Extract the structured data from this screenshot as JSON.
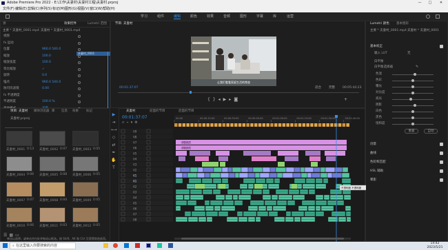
{
  "window": {
    "title": "Adobe Premiere Pro 2022 - E:\\工作\\夫妻村\\夫妻村工程\\夫妻村.prproj",
    "controls": [
      "—",
      "□",
      "✕"
    ]
  },
  "menu": [
    "文件(F)",
    "编辑(E)",
    "剪辑(C)",
    "序列(S)",
    "标记(M)",
    "图形(G)",
    "视图(V)",
    "窗口(W)",
    "帮助(H)"
  ],
  "workspaces": [
    "学习",
    "组件",
    "编辑",
    "颜色",
    "效果",
    "音频",
    "图形",
    "字幕",
    "库",
    "运营"
  ],
  "active_workspace": "编辑",
  "effect_controls": {
    "tabs": [
      "效果控件",
      "Lumetri 范围",
      "源",
      "音频剪辑混合器"
    ],
    "source": "主要 * 夫妻村_0001.mp4",
    "sequence": "夫妻村 * 夫妻村_0001.mp4",
    "clip_name": "夫妻村_0001",
    "rows": [
      {
        "label": "视频",
        "value": ""
      },
      {
        "label": "fx 运动",
        "value": ""
      },
      {
        "label": "位置",
        "value": "960.0   540.0"
      },
      {
        "label": "缩放",
        "value": "100.0"
      },
      {
        "label": "缩放宽度",
        "value": "100.0"
      },
      {
        "label": "等比缩放",
        "value": "✓"
      },
      {
        "label": "旋转",
        "value": "0.0"
      },
      {
        "label": "锚点",
        "value": "960.0   540.0"
      },
      {
        "label": "防闪烁滤镜",
        "value": "0.00"
      },
      {
        "label": "fx 不透明度",
        "value": ""
      },
      {
        "label": "不透明度",
        "value": "100.0 %"
      },
      {
        "label": "混合模式",
        "value": "正常"
      },
      {
        "label": "fx 时间重映射",
        "value": ""
      }
    ],
    "timecode": "00:01:37:07"
  },
  "program": {
    "tab": "节目: 夫妻村",
    "caption": "让我们看看家庭生活的常态",
    "timecode_left": "00:01:37:07",
    "fit": "适合",
    "quality": "完整",
    "timecode_right": "00:05:44:23"
  },
  "project": {
    "tabs": [
      "项目: 夫妻村",
      "媒体浏览器",
      "库",
      "信息",
      "效果",
      "标记",
      "历史记录"
    ],
    "path": "夫妻村.prproj",
    "items": [
      {
        "name": "夫妻村_0001",
        "duration": "0:13"
      },
      {
        "name": "夫妻村_0002",
        "duration": "0:07"
      },
      {
        "name": "夫妻村_0003",
        "duration": "0:05"
      },
      {
        "name": "夫妻村_0004",
        "duration": "0:06"
      },
      {
        "name": "夫妻村_0005",
        "duration": "0:08"
      },
      {
        "name": "夫妻村_0006",
        "duration": "0:05"
      },
      {
        "name": "夫妻村_0007",
        "duration": "0:07"
      },
      {
        "name": "夫妻村_0008",
        "duration": "0:04"
      },
      {
        "name": "夫妻村_0009",
        "duration": "0:05"
      },
      {
        "name": "夫妻村_0010",
        "duration": "0:06"
      },
      {
        "name": "夫妻村_0011",
        "duration": "0:03"
      },
      {
        "name": "夫妻村_0012",
        "duration": "0:05"
      }
    ]
  },
  "timeline": {
    "tabs": [
      "夫妻村",
      "前面的节目",
      "后面的节目"
    ],
    "timecode": "00:01:37:07",
    "ruler": [
      "00:00",
      "00:00:15:00",
      "00:00:30:00",
      "00:00:45:00",
      "00:01:00:00",
      "00:01:15:00",
      "00:01:30:00",
      "00:01:45:00"
    ],
    "tracks": [
      "V9",
      "V8",
      "V7",
      "V6",
      "V5",
      "V4",
      "V3",
      "V2",
      "V1",
      "A1",
      "A2",
      "A3",
      "A4",
      "A5",
      "A6",
      "A7",
      "A8"
    ],
    "tooltip": "不透明度 不透明度",
    "clip_label": "调整图层"
  },
  "lumetri": {
    "tabs": [
      "Lumetri 颜色",
      "基本图形"
    ],
    "source": "主要 * 夫妻村_0001.mp4",
    "sequence": "夫妻村 * 夫妻村_0001",
    "section_basic": "基本校正",
    "input_lut": "输入 LUT",
    "input_lut_value": "无",
    "section_wb": "白平衡",
    "wb_selector": "白平衡选择器",
    "sliders": [
      "色温",
      "色彩",
      "曝光",
      "对比度",
      "高光",
      "阴影",
      "白色",
      "黑色",
      "饱和度"
    ],
    "reset_label": "重置",
    "auto_label": "自动",
    "sections": [
      "创意",
      "曲线",
      "色轮和匹配",
      "HSL 辅助",
      "晕影"
    ]
  },
  "taskbar": {
    "search": "在这里输入你要搜索的内容",
    "time": "14:42",
    "date": "2023/5/21"
  },
  "status_hint": "单击以选择，或单击空白处并拖动以框选。按 Shift、Alt 和 Ctrl 可获得其他选项。",
  "colors": {
    "accent": "#2d8ceb",
    "video_clip": "#d792e6",
    "audio_clip": "#56c3a1",
    "orange": "#e0a64b",
    "green": "#8fd36f"
  }
}
